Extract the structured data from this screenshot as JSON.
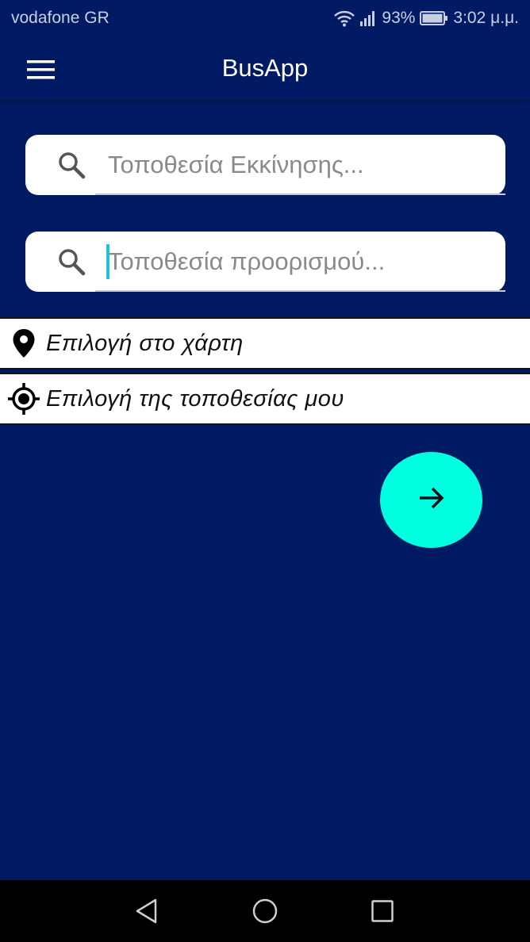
{
  "status_bar": {
    "carrier": "vodafone GR",
    "battery_percent": "93%",
    "time": "3:02 μ.μ."
  },
  "app_bar": {
    "title": "BusApp",
    "menu_icon": "hamburger-menu-icon"
  },
  "search": {
    "start_placeholder": "Τοποθεσία Εκκίνησης...",
    "start_value": "",
    "destination_placeholder": "Τοποθεσία προορισμού...",
    "destination_value": "",
    "icon": "search-icon"
  },
  "options": [
    {
      "label": "Επιλογή στο χάρτη",
      "icon": "map-pin-icon"
    },
    {
      "label": "Επιλογή της τοποθεσίας μου",
      "icon": "my-location-icon"
    }
  ],
  "fab": {
    "icon": "arrow-right-icon"
  },
  "navigation": {
    "back_icon": "back-triangle-icon",
    "home_icon": "home-circle-icon",
    "recents_icon": "recents-square-icon"
  },
  "colors": {
    "background": "#001a63",
    "fab": "#00ffe0",
    "caret": "#1ec3d6",
    "nav_bar": "#000000"
  }
}
